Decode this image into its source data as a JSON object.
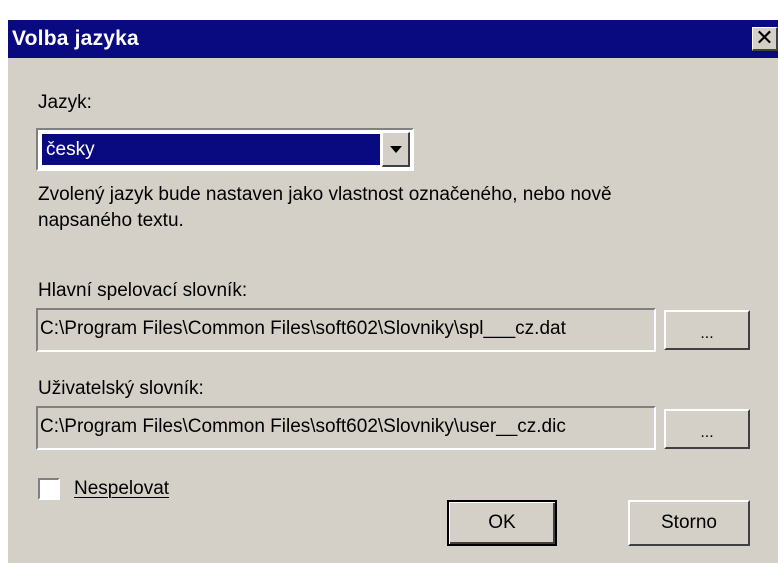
{
  "window": {
    "title": "Volba jazyka",
    "close_glyph": "✕"
  },
  "language": {
    "label": "Jazyk:",
    "selected": "česky",
    "description_line1": "Zvolený jazyk bude nastaven jako vlastnost označeného, nebo nově",
    "description_line2": "napsaného textu."
  },
  "main_dictionary": {
    "label": "Hlavní spelovací slovník:",
    "path": "C:\\Program Files\\Common Files\\soft602\\Slovniky\\spl___cz.dat",
    "browse_label": "..."
  },
  "user_dictionary": {
    "label": "Uživatelský slovník:",
    "path": "C:\\Program Files\\Common Files\\soft602\\Slovniky\\user__cz.dic",
    "browse_label": "..."
  },
  "no_spellcheck": {
    "label": "Nespelovat",
    "checked": false
  },
  "buttons": {
    "ok": "OK",
    "cancel": "Storno"
  }
}
